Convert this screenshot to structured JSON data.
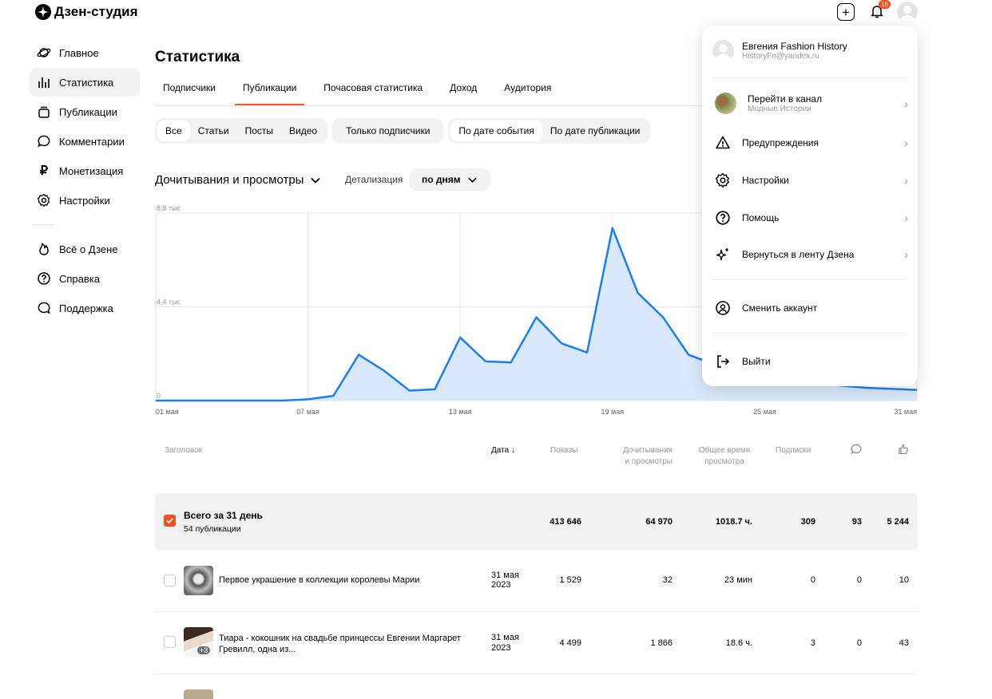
{
  "app": {
    "title": "Дзен-студия",
    "notification_count": "16"
  },
  "sidebar": {
    "items": [
      {
        "label": "Главное",
        "icon": "planet-icon",
        "active": false
      },
      {
        "label": "Статистика",
        "icon": "bar-chart-icon",
        "active": true
      },
      {
        "label": "Публикации",
        "icon": "publications-icon",
        "active": false
      },
      {
        "label": "Комментарии",
        "icon": "comment-icon",
        "active": false
      },
      {
        "label": "Монетизация",
        "icon": "ruble-icon",
        "active": false
      },
      {
        "label": "Настройки",
        "icon": "gear-icon",
        "active": false
      }
    ],
    "bottom_items": [
      {
        "label": "Всё о Дзене",
        "icon": "flame-icon"
      },
      {
        "label": "Справка",
        "icon": "help-icon"
      },
      {
        "label": "Поддержка",
        "icon": "chat-icon"
      }
    ]
  },
  "page": {
    "title": "Статистика",
    "tabs": [
      {
        "label": "Подписчики",
        "active": false
      },
      {
        "label": "Публикации",
        "active": true
      },
      {
        "label": "Почасовая статистика",
        "active": false
      },
      {
        "label": "Доход",
        "active": false
      },
      {
        "label": "Аудитория",
        "active": false
      }
    ],
    "filter_type": [
      "Все",
      "Статьи",
      "Посты",
      "Видео"
    ],
    "filter_subscribers": "Только подписчики",
    "filter_date": [
      "По дате события",
      "По дате публикации"
    ],
    "metric_label": "Дочитывания и просмотры",
    "detail_label": "Детализация",
    "detail_value": "по дням"
  },
  "chart_data": {
    "type": "area",
    "y_ticks": [
      "8,8 тыс",
      "4,4 тыс",
      "0"
    ],
    "x_ticks": [
      "01 мая",
      "07 мая",
      "13 мая",
      "19 мая",
      "25 мая",
      "31 мая"
    ],
    "ylim": [
      0,
      8800
    ],
    "x": [
      1,
      2,
      3,
      4,
      5,
      6,
      7,
      8,
      9,
      10,
      11,
      12,
      13,
      14,
      15,
      16,
      17,
      18,
      19,
      20,
      21,
      22,
      23,
      24,
      25,
      26,
      27,
      28,
      29,
      30,
      31
    ],
    "values": [
      0,
      0,
      0,
      0,
      0,
      0,
      60,
      220,
      2150,
      1400,
      470,
      530,
      2960,
      1840,
      1790,
      3910,
      2680,
      2260,
      8100,
      5050,
      3900,
      2150,
      1700,
      1400,
      1100,
      900,
      800,
      700,
      600,
      550,
      500
    ],
    "color": "#1a7ef5",
    "fill": "#d9e9fb",
    "grid": true
  },
  "table": {
    "headers": {
      "title": "Заголовок",
      "date": "Дата",
      "shows": "Показы",
      "reads_1": "Дочитывания",
      "reads_2": "и просмотры",
      "time_1": "Общее время",
      "time_2": "просмотра",
      "subs": "Подписки"
    },
    "total": {
      "title": "Всего за 31 день",
      "subtitle": "54 публикации",
      "shows": "413 646",
      "reads": "64 970",
      "time": "1018.7 ч.",
      "subs": "309",
      "comments": "93",
      "likes": "5 244"
    },
    "rows": [
      {
        "title": "Первое украшение в коллекции королевы Марии",
        "title_2": "",
        "date_1": "31 мая",
        "date_2": "2023",
        "shows": "1 529",
        "reads": "32",
        "time": "23 мин",
        "subs": "0",
        "comments": "0",
        "likes": "10",
        "badge": ""
      },
      {
        "title": "Тиара - кокошник на свадьбе принцессы Евгении Маргарет",
        "title_2": "Гревилл, одна из...",
        "date_1": "31 мая",
        "date_2": "2023",
        "shows": "4 499",
        "reads": "1 866",
        "time": "18.6 ч.",
        "subs": "3",
        "comments": "0",
        "likes": "43",
        "badge": "+3"
      }
    ]
  },
  "dropdown": {
    "user_name": "Евгения Fashion History",
    "user_email": "HistoryFn@yandex.ru",
    "channel_label": "Перейти в канал",
    "channel_sub": "Модные Истории",
    "items": [
      "Предупреждения",
      "Настройки",
      "Помощь",
      "Вернуться в ленту Дзена"
    ],
    "switch_account": "Сменить аккаунт",
    "logout": "Выйти"
  }
}
